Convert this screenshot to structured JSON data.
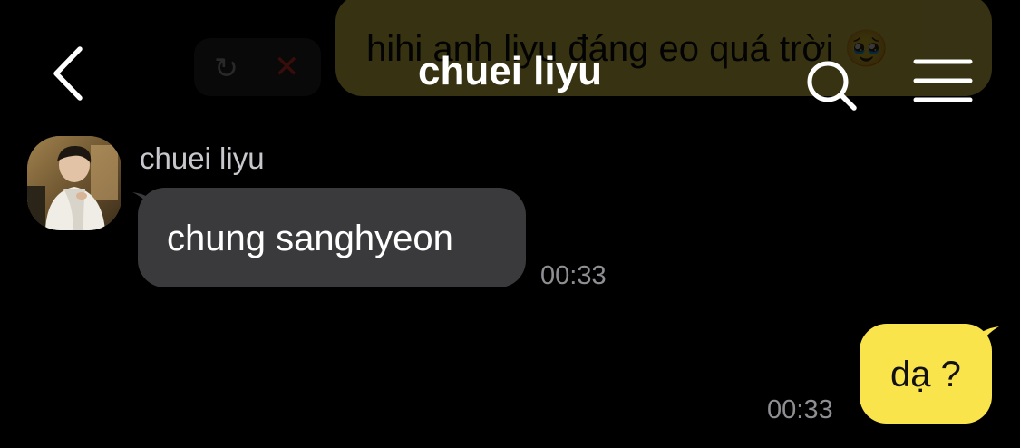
{
  "header": {
    "title": "chuei liyu",
    "back_icon": "chevron-left-icon",
    "search_icon": "search-icon",
    "menu_icon": "hamburger-menu-icon"
  },
  "ghost": {
    "text": "hihi anh liyu đáng eo quá trời 🥹",
    "retry_icon": "↻",
    "delete_icon": "✕"
  },
  "messages": [
    {
      "direction": "incoming",
      "sender": "chuei liyu",
      "text": "chung sanghyeon",
      "time": "00:33"
    },
    {
      "direction": "outgoing",
      "text": "dạ ?",
      "time": "00:33"
    }
  ],
  "colors": {
    "background": "#000000",
    "incoming_bubble": "#3a3a3c",
    "outgoing_bubble": "#fae44b",
    "timestamp": "#8e8e93"
  }
}
